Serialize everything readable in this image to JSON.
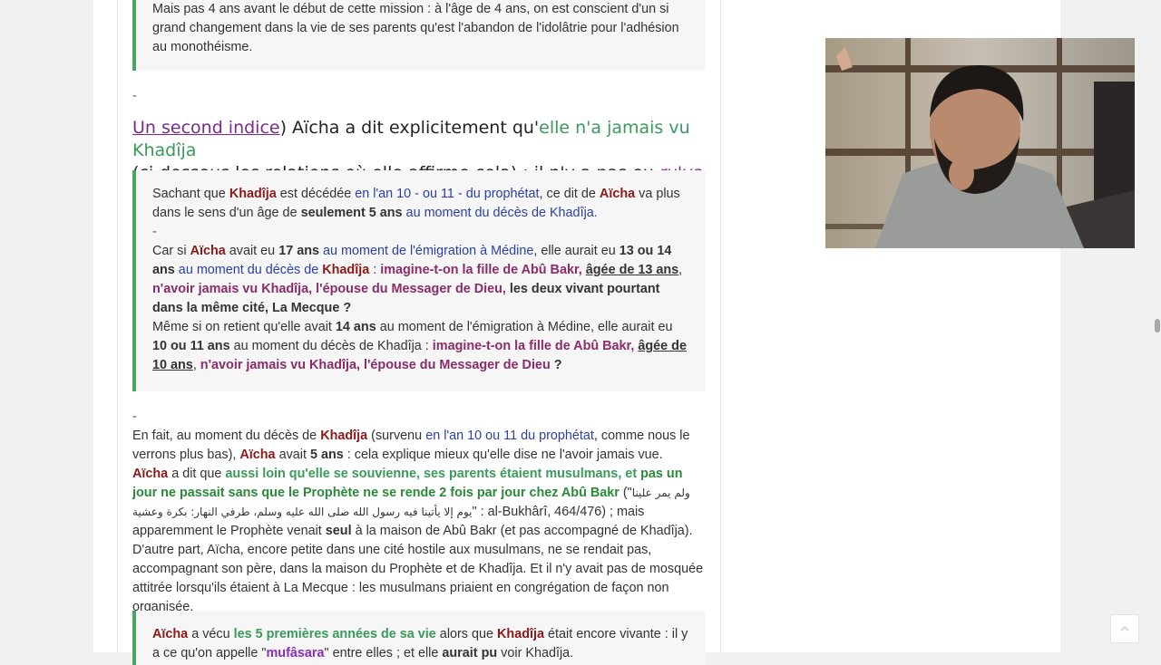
{
  "intro_quote": {
    "text": "Mais pas 4 ans avant le début de cette mission : à l'âge de 4 ans, on est conscient d'un si grand changement dans la vie de ses parents qu'est l'abandon de l'idolâtrie pour l'adhésion au monothéisme."
  },
  "separator": "-",
  "heading": {
    "link_text": "Un second indice",
    "part1": ") Aïcha a dit explicitement qu'",
    "green_text": "elle n'a jamais vu Khadîja",
    "part2": "(ci-dessous les relations où elle affirme cela) : il n'y a pas eu ",
    "ruya": "ru'ya",
    "colon": " :"
  },
  "quote_box": {
    "p1": {
      "t1": "Sachant que ",
      "khadija": "Khadîja",
      "t2": " est décédée ",
      "blue1": "en l'an 10 - ou 11 - du prophétat",
      "t3": ", ce dit de ",
      "aicha": "Aïcha",
      "t4": " va plus dans le sens d'un âge de ",
      "bold": "seulement 5 ans",
      "blue2": " au moment du décès de Khadîja."
    },
    "dash": "-",
    "p2": {
      "t1": "Car si ",
      "aicha": "Aïcha",
      "t2": " avait eu ",
      "b1": "17 ans",
      "blue1": " au moment de l'émigration à Médine",
      "t3": ", elle aurait eu ",
      "b2": "13 ou 14 ans",
      "blue2": " au moment du décès de ",
      "khadija": "Khadîja",
      "t4": " : ",
      "m1": "imagine-t-on la fille de Abû Bakr,",
      "u1": "âgée de 13 ans",
      "t5": ",",
      "m2": "n'avoir jamais vu Khadîja, l'épouse du Messager de Dieu,",
      "b3": " les deux vivant pourtant dans la même cité, La Mecque",
      "t6": " ?"
    },
    "p3": {
      "t1": "Même si on retient qu'elle avait ",
      "b1": "14 ans",
      "t2": " au moment de l'émigration à Médine, elle aurait eu ",
      "b2": "10 ou 11 ans",
      "t3": " au moment du décès de Khadîja : ",
      "m1": "imagine-t-on la fille de Abû Bakr,",
      "u1": "âgée de 10 ans",
      "t4": ",",
      "m2": " n'avoir jamais vu Khadîja, l'épouse du Messager de Dieu",
      "t5": " ?"
    }
  },
  "body": {
    "dash": "-",
    "p1": {
      "t1": "En fait, au moment du décès de ",
      "khadija": "Khadîja",
      "t2": " (survenu ",
      "blue": "en l'an 10 ou 11 du prophétat",
      "t3": ", comme nous le verrons plus bas), ",
      "aicha": "Aïcha",
      "t4": " avait ",
      "b1": "5 ans",
      "t5": " : cela explique mieux qu'elle dise ne l'avoir jamais vue."
    },
    "p2": {
      "aicha": "Aïcha",
      "t1": " a dit que ",
      "g1": "aussi loin qu'elle se souvienne, ses parents étaient musulmans, et",
      "g2": " pas un jour ne passait sans que le Prophète ne se rende 2 fois par jour chez Abû Bakr",
      "t2": " (\"",
      "arabic": "ولم يمر علينا يوم إلا يأتينا فيه رسول الله صلى الله عليه وسلم، طرفي النهار: بكرة وعشية",
      "t3": "\" : al-Bukhârî, 464/476) ; mais apparemment le Prophète venait ",
      "b1": "seul",
      "t4": " à la maison de Abû Bakr (et pas accompagné de Khadîja). D'autre part, Aïcha, encore petite dans une cité hostile aux musulmans, ne se rendait pas, accompagnant son père, dans la maison du Prophète et de Khadîja. Et il n'y avait pas de mosquée attitrée lorsqu'ils étaient à La Mecque : les musulmans priaient en congrégation de façon non organisée."
    }
  },
  "bottom_quote": {
    "aicha": "Aïcha",
    "t1": " a vécu ",
    "g1": "les 5 premières années de sa vie",
    "t2": " alors que ",
    "khadija": "Khadîja",
    "t3": " était encore vivante : il y a ce qu'on appelle \"",
    "m1": "mufâsara",
    "t4": "\" entre elles ; et elle ",
    "b1": "aurait pu",
    "t5": " voir Khadîja."
  },
  "icons": {
    "scroll_top": "chevron-up-icon"
  }
}
